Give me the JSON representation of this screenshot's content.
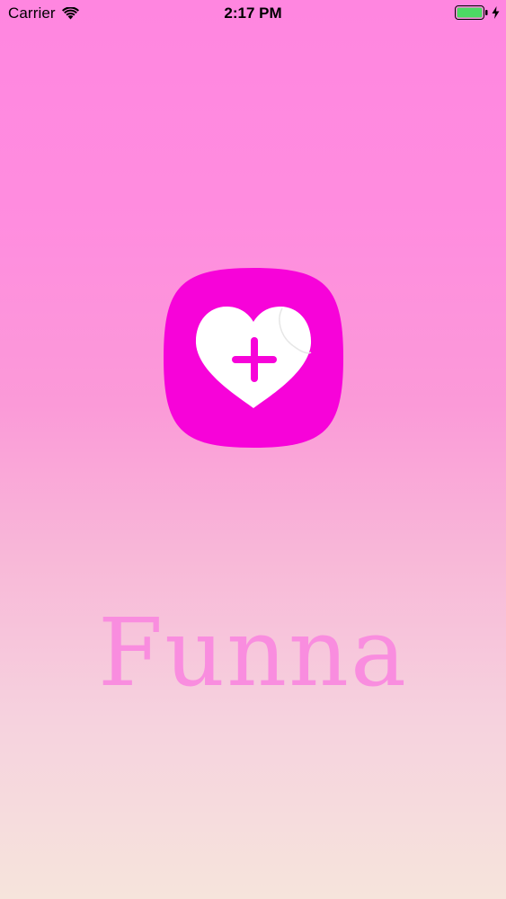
{
  "status_bar": {
    "carrier": "Carrier",
    "time": "2:17 PM",
    "wifi_icon": "wifi-icon",
    "battery_icon": "battery-icon",
    "battery_level": 1.0,
    "battery_color": "#4cd964",
    "charging_icon": "bolt-icon"
  },
  "splash": {
    "app_icon": "heart-plus-icon",
    "icon_color": "#f703d9",
    "app_name": "Funna",
    "app_name_color": "#f98ddf"
  }
}
